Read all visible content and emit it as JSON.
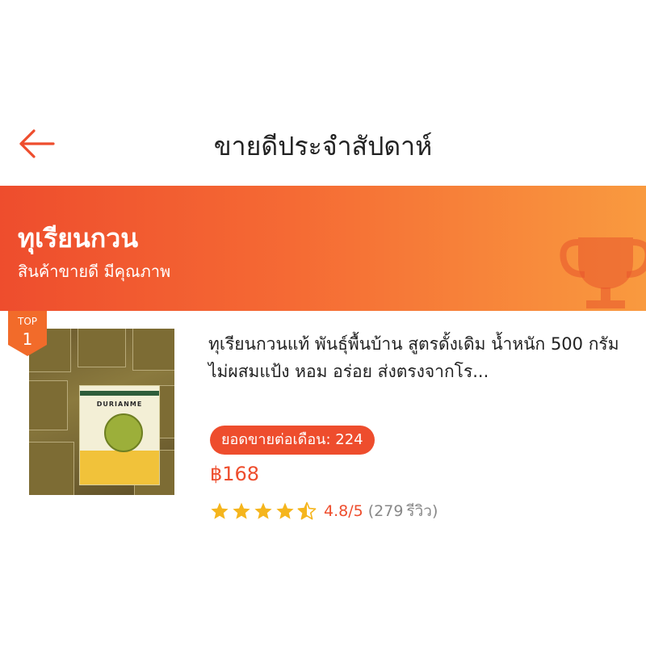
{
  "header": {
    "title": "ขายดีประจำสัปดาห์",
    "back_icon": "back-arrow-icon"
  },
  "banner": {
    "title": "ทุเรียนกวน",
    "subtitle": "สินค้าขายดี มีคุณภาพ",
    "icon": "trophy-icon"
  },
  "product": {
    "rank_label": "TOP",
    "rank_number": "1",
    "image_brand_text": "DURIANME",
    "name": "ทุเรียนกวนแท้ พันธุ์พื้นบ้าน สูตรดั้งเดิม น้ำหนัก 500 กรัม ไม่ผสมแป้ง หอม อร่อย ส่งตรงจากโร...",
    "monthly_sales": "ยอดขายต่อเดือน: 224",
    "price": "฿168",
    "rating": "4.8/5",
    "rating_stars": 4.8,
    "review_open": "(",
    "review_count": "279",
    "review_label": "รีวิว",
    "review_close": ")"
  },
  "colors": {
    "accent": "#ee4d2d",
    "banner_end": "#f99a3f",
    "star": "#f5b51d"
  }
}
